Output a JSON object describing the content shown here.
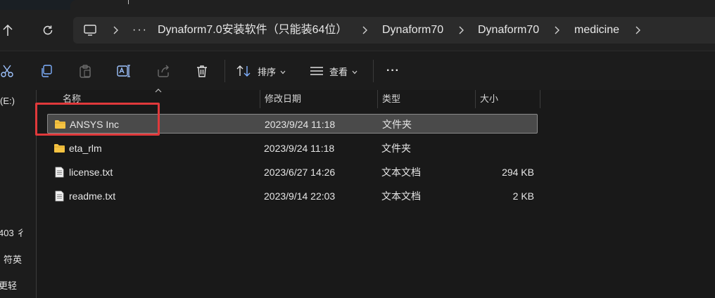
{
  "address": {
    "ellipsis": "···",
    "crumbs": [
      "Dynaform7.0安装软件（只能装64位）",
      "Dynaform70",
      "Dynaform70",
      "medicine"
    ]
  },
  "toolbar": {
    "sort_label": "排序",
    "view_label": "查看",
    "more_label": "···"
  },
  "leftpane": {
    "drive_label": "(E:)",
    "frag1": "403 彳",
    "frag2": "符英",
    "frag3": "更轻"
  },
  "columns": {
    "name": "名称",
    "modified": "修改日期",
    "type": "类型",
    "size": "大小"
  },
  "files": [
    {
      "name": "ANSYS Inc",
      "modified": "2023/9/24 11:18",
      "type": "文件夹",
      "size": "",
      "icon": "folder-icon",
      "selected": true
    },
    {
      "name": "eta_rlm",
      "modified": "2023/9/24 11:18",
      "type": "文件夹",
      "size": "",
      "icon": "folder-icon",
      "selected": false
    },
    {
      "name": "license.txt",
      "modified": "2023/6/27 14:26",
      "type": "文本文档",
      "size": "294 KB",
      "icon": "text-file-icon",
      "selected": false
    },
    {
      "name": "readme.txt",
      "modified": "2023/9/14 22:03",
      "type": "文本文档",
      "size": "2 KB",
      "icon": "text-file-icon",
      "selected": false
    }
  ],
  "colors": {
    "highlight_box": "#e0393b",
    "folder": "#f5c342",
    "selection": "#4a4a4a"
  }
}
